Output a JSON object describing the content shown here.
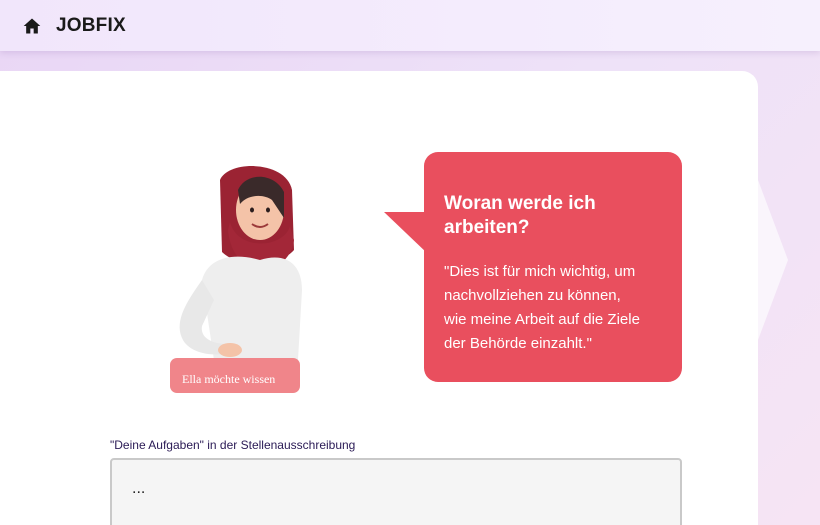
{
  "header": {
    "brand": "JOBFIX",
    "home_icon": "home-icon"
  },
  "character": {
    "badge": "Ella möchte wissen"
  },
  "bubble": {
    "title_line1": "Woran werde ich",
    "title_line2": "arbeiten?",
    "text_line1": "\"Dies ist für mich wichtig, um",
    "text_line2": "nachvollziehen zu können,",
    "text_line3": "wie meine Arbeit auf die Ziele",
    "text_line4": "der Behörde einzahlt.\"",
    "color": "#e94f5e"
  },
  "form": {
    "label": "\"Deine Aufgaben\" in der Stellenausschreibung",
    "value": "..."
  }
}
